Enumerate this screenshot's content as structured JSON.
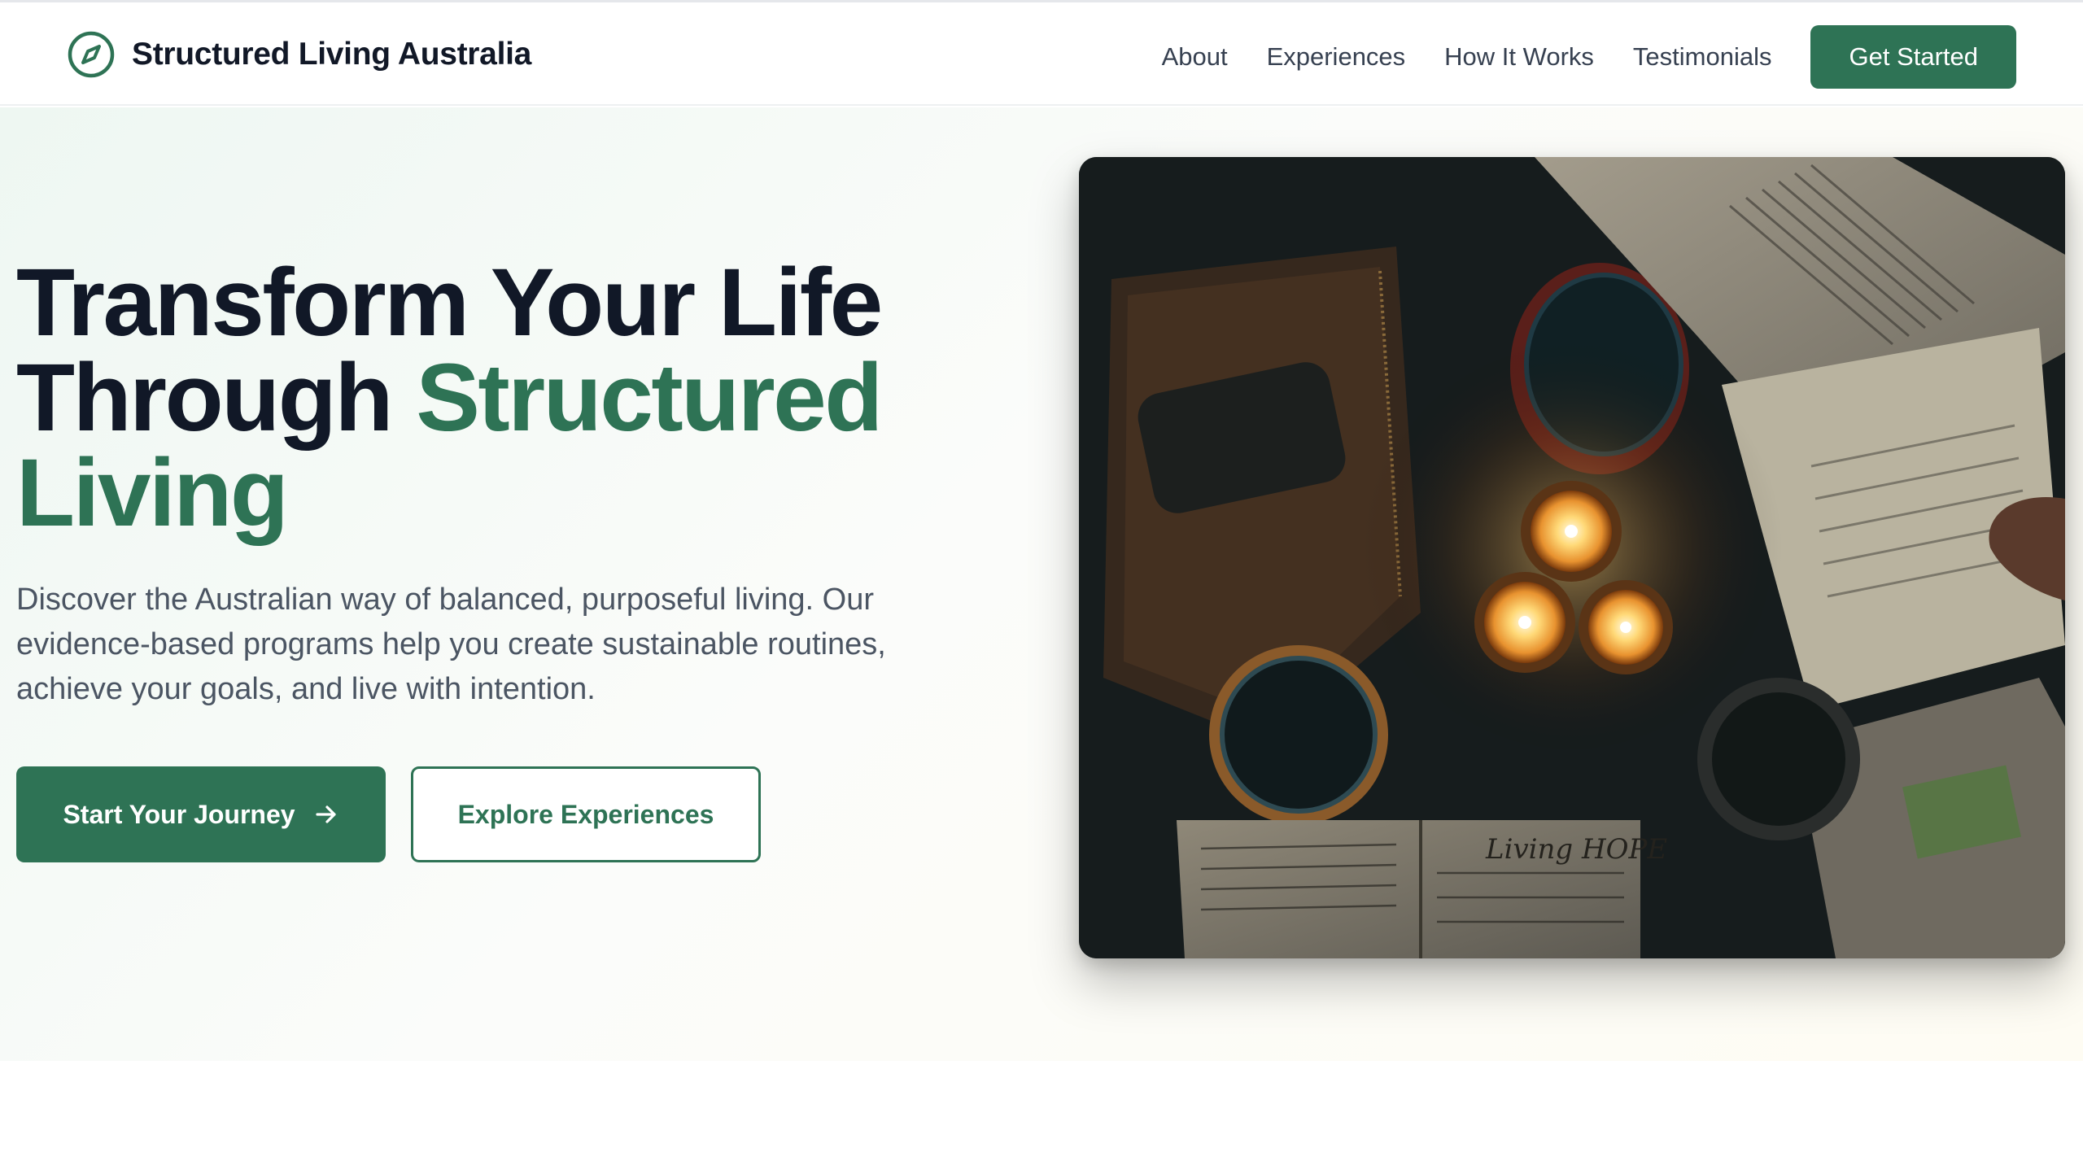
{
  "brand": {
    "name": "Structured Living Australia",
    "icon": "compass-icon"
  },
  "nav": {
    "items": [
      {
        "label": "About"
      },
      {
        "label": "Experiences"
      },
      {
        "label": "How It Works"
      },
      {
        "label": "Testimonials"
      }
    ],
    "cta_label": "Get Started"
  },
  "hero": {
    "headline_part1": "Transform Your Life Through ",
    "headline_accent": "Structured Living",
    "subtitle": "Discover the Australian way of balanced, purposeful living. Our evidence-based programs help you create sustainable routines, achieve your goals, and live with intention.",
    "primary_button": "Start Your Journey",
    "primary_button_icon": "arrow-right-icon",
    "secondary_button": "Explore Experiences",
    "image_handwriting": "Living HOPE"
  },
  "colors": {
    "accent": "#2e7355",
    "heading": "#111827",
    "body_text": "#4b5563"
  }
}
